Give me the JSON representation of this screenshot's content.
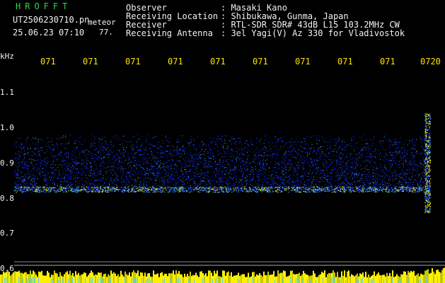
{
  "brand": "HROFFT",
  "file": {
    "name": "UT2506230710.pn",
    "tag": "meteor"
  },
  "datetime": "25.06.23 07:10",
  "counter": "77.",
  "header": [
    {
      "label": "Observer",
      "value": ": Masaki Kano"
    },
    {
      "label": "Receiving Location",
      "value": ": Shibukawa, Gunma, Japan"
    },
    {
      "label": "Receiver",
      "value": ": RTL-SDR SDR# 43dB L15 103.2MHz CW"
    },
    {
      "label": "Receiving Antenna",
      "value": ": 3el Yagi(V) Az 330 for Vladivostok"
    }
  ],
  "y_axis": {
    "unit": "kHz",
    "ticks": [
      "1.1",
      "1.0",
      "0.9",
      "0.8",
      "0.7",
      "0.6"
    ]
  },
  "x_axis": {
    "ticks": [
      "071",
      "071",
      "071",
      "071",
      "071",
      "071",
      "071",
      "071",
      "071",
      "0720"
    ]
  },
  "colors": {
    "background": "#000000",
    "title_green": "#2fd64a",
    "tick_yellow": "#ffe300",
    "text_white": "#f2f2f2",
    "signal_low": "#1a2cff",
    "signal_mid": "#33aaff",
    "signal_high": "#fff000",
    "bars_cyan": "#3fd6ff"
  },
  "chart_data": {
    "type": "heatmap",
    "y_unit": "kHz",
    "y_ticks": [
      1.1,
      1.0,
      0.9,
      0.8,
      0.7,
      0.6
    ],
    "ylim": [
      0.6,
      1.1
    ],
    "carrier_band_khz": [
      0.82,
      0.98
    ],
    "strong_carrier_khz": 0.825,
    "meteor_echo_position": "right-edge"
  }
}
